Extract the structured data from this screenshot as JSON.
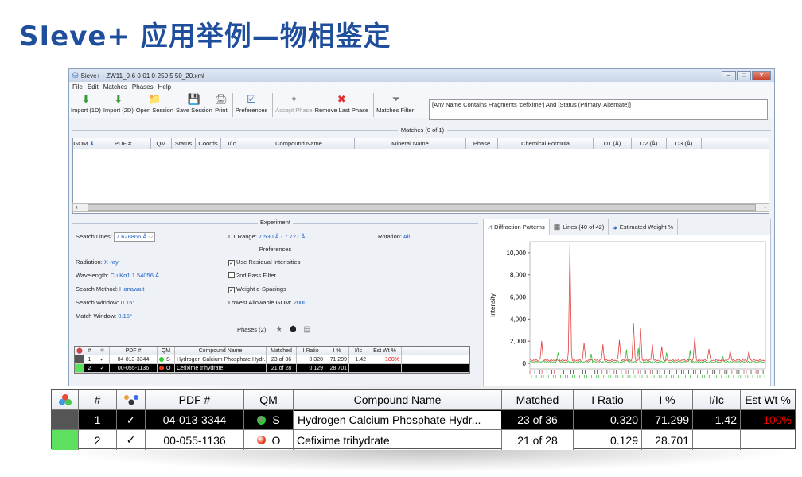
{
  "slide": {
    "title": "SIeve+ 应用举例—物相鉴定"
  },
  "window": {
    "title": "Sieve+ - ZW11_0-6 0-01 0-250 5 50_20.xml",
    "controls": [
      "–",
      "□",
      "✕"
    ]
  },
  "menu": [
    "File",
    "Edit",
    "Matches",
    "Phases",
    "Help"
  ],
  "toolbar": {
    "buttons": [
      {
        "label": "Import (1D)",
        "icon": "import-1d-icon",
        "glyph": "⬇",
        "color": "#3a9a3a",
        "enabled": true
      },
      {
        "label": "Import (2D)",
        "icon": "import-2d-icon",
        "glyph": "⬇",
        "color": "#3a9a3a",
        "enabled": true
      },
      {
        "label": "Open Session",
        "icon": "folder-icon",
        "glyph": "📁",
        "color": "#e8b923",
        "enabled": true
      },
      {
        "label": "Save Session",
        "icon": "save-icon",
        "glyph": "💾",
        "color": "#2a5fa8",
        "enabled": true
      },
      {
        "label": "Print",
        "icon": "print-icon",
        "glyph": "🖨",
        "color": "#666",
        "enabled": true
      },
      {
        "label": "Preferences",
        "icon": "preferences-icon",
        "glyph": "☑",
        "color": "#2a5fa8",
        "enabled": true
      },
      {
        "label": "Accept Phase",
        "icon": "accept-phase-icon",
        "glyph": "✦",
        "color": "#999",
        "enabled": false
      },
      {
        "label": "Remove Last Phase",
        "icon": "remove-icon",
        "glyph": "✖",
        "color": "#d33",
        "enabled": true
      },
      {
        "label": "Matches Filter:",
        "icon": "filter-icon",
        "glyph": "⏷",
        "color": "#777",
        "enabled": true
      }
    ],
    "filter_text": "[Any Name Contains Fragments 'cefixime'] And [Status (Primary, Alternate)]"
  },
  "matches": {
    "label": "Matches (0 of 1)",
    "columns": [
      "GOM",
      "PDF #",
      "QM",
      "Status",
      "Coords",
      "I/Ic",
      "Compound Name",
      "Mineral Name",
      "Phase",
      "Chemical Formula",
      "D1 (Å)",
      "D2 (Å)",
      "D3 (Å)"
    ],
    "sort_glyph": "⬇"
  },
  "experiment": {
    "label": "Experiment",
    "search_lines_label": "Search Lines:",
    "search_lines_value": "7.628866 Å",
    "d1_range_label": "D1 Range:",
    "d1_range_value": "7.530 Å - 7.727 Å",
    "rotation_label": "Rotation:",
    "rotation_value": "All"
  },
  "preferences": {
    "label": "Preferences",
    "radiation_label": "Radiation:",
    "radiation_value": "X-ray",
    "wavelength_label": "Wavelength:",
    "wavelength_value": "Cu Kα1 1.54056 Å",
    "search_method_label": "Search Method:",
    "search_method_value": "Hanawalt",
    "search_window_label": "Search Window:",
    "search_window_value": "0.15°",
    "match_window_label": "Match Window:",
    "match_window_value": "0.15°",
    "use_residual": {
      "label": "Use Residual Intensities",
      "checked": true
    },
    "second_pass": {
      "label": "2nd Pass Filter",
      "checked": false
    },
    "weight_d": {
      "label": "Weight d-Spacings",
      "checked": true
    },
    "lowest_gom_label": "Lowest Allowable GOM:",
    "lowest_gom_value": "2000"
  },
  "phases": {
    "label": "Phases (2)",
    "columns": [
      "#",
      "PDF #",
      "QM",
      "Compound Name",
      "Matched",
      "I Ratio",
      "I %",
      "I/Ic",
      "Est Wt %"
    ],
    "rows": [
      {
        "num": "1",
        "check": "✓",
        "pdf": "04-013-3344",
        "qm_color": "#2ecc2e",
        "qm": "S",
        "name": "Hydrogen Calcium Phosphate Hydr...",
        "matched": "23 of 36",
        "iratio": "0.320",
        "ipct": "71.299",
        "iic": "1.42",
        "estwt": "100%",
        "swatch": "#555555"
      },
      {
        "num": "2",
        "check": "✓",
        "pdf": "00-055-1136",
        "qm_color": "#e83a1a",
        "qm": "O",
        "name": "Cefixime trihydrate",
        "matched": "21 of 28",
        "iratio": "0.129",
        "ipct": "28.701",
        "iic": "",
        "estwt": "",
        "swatch": "#5de05d"
      }
    ]
  },
  "tabs": [
    {
      "label": "Diffraction Patterns",
      "icon": "diffraction-icon",
      "active": true
    },
    {
      "label": "Lines (40 of 42)",
      "icon": "grid-icon",
      "active": false
    },
    {
      "label": "Estimated Weight %",
      "icon": "pie-icon",
      "active": false
    }
  ],
  "chart_data": {
    "type": "line",
    "ylabel": "Intensity",
    "ylim": [
      -500,
      11000
    ],
    "yticks": [
      "10,000",
      "8,000",
      "6,000",
      "4,000",
      "2,000",
      "0"
    ],
    "ytick_values": [
      10000,
      8000,
      6000,
      4000,
      2000,
      0
    ],
    "series": [
      {
        "color": "#e04040",
        "peaks": [
          [
            0.05,
            1700
          ],
          [
            0.17,
            10600
          ],
          [
            0.23,
            1600
          ],
          [
            0.31,
            1400
          ],
          [
            0.38,
            1900
          ],
          [
            0.44,
            3400
          ],
          [
            0.47,
            2800
          ],
          [
            0.52,
            1400
          ],
          [
            0.56,
            1200
          ],
          [
            0.7,
            2100
          ],
          [
            0.76,
            1100
          ],
          [
            0.85,
            900
          ],
          [
            0.93,
            800
          ]
        ]
      },
      {
        "color": "#3ab83a",
        "peaks": [
          [
            0.12,
            900
          ],
          [
            0.26,
            700
          ],
          [
            0.41,
            1100
          ],
          [
            0.46,
            1200
          ],
          [
            0.58,
            800
          ],
          [
            0.68,
            1000
          ],
          [
            0.82,
            500
          ]
        ]
      }
    ]
  }
}
